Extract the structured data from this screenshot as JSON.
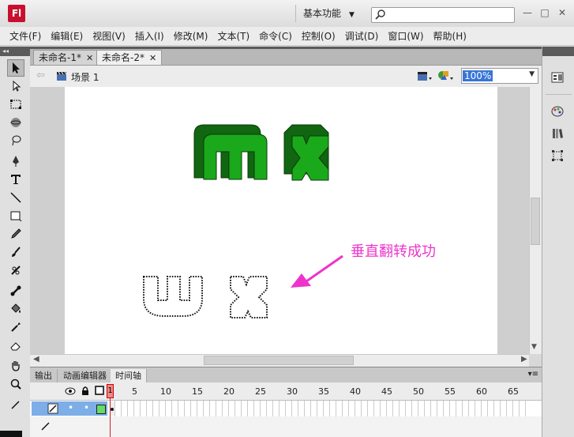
{
  "app": {
    "logo": "Fl",
    "workspace": "基本功能"
  },
  "window_buttons": [
    "—",
    "□",
    "✕"
  ],
  "menu": [
    "文件(F)",
    "编辑(E)",
    "视图(V)",
    "插入(I)",
    "修改(M)",
    "文本(T)",
    "命令(C)",
    "控制(O)",
    "调试(D)",
    "窗口(W)",
    "帮助(H)"
  ],
  "tabs": [
    {
      "label": "未命名-1*",
      "close": "✕",
      "active": false
    },
    {
      "label": "未命名-2*",
      "close": "✕",
      "active": true
    }
  ],
  "scene": {
    "label": "场景 1",
    "zoom": "100%"
  },
  "stage": {
    "annotation": "垂直翻转成功",
    "annotation_color": "#ee33cc",
    "letter_fill": "#1aa91a",
    "letter_dark": "#116611"
  },
  "timeline": {
    "tabs": [
      "输出",
      "动画编辑器",
      "时间轴"
    ],
    "active_tab": "时间轴",
    "frame_numbers": [
      "1",
      "5",
      "10",
      "15",
      "20",
      "25",
      "30",
      "35",
      "40",
      "45",
      "50",
      "55",
      "60",
      "65"
    ],
    "layer_dots": [
      "•",
      "•"
    ],
    "layer_color": "#66dd66"
  },
  "icons": {
    "toolbox": [
      "selection-arrow-icon",
      "subselection-icon",
      "free-transform-icon",
      "3d-rotation-icon",
      "lasso-icon",
      "pen-icon",
      "text-icon",
      "line-icon",
      "rectangle-icon",
      "pencil-icon",
      "brush-icon",
      "deco-icon",
      "bone-icon",
      "paint-bucket-icon",
      "eyedropper-icon",
      "eraser-icon",
      "hand-icon",
      "zoom-icon"
    ],
    "right_panel": [
      "properties-icon",
      "color-icon",
      "library-icon",
      "transform-icon"
    ]
  }
}
